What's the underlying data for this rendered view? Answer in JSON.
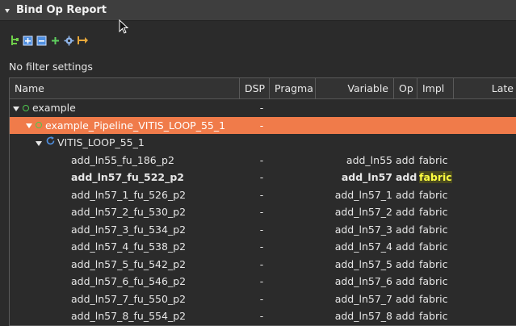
{
  "panel": {
    "title": "Bind Op Report"
  },
  "toolbar": {
    "icons": [
      "hierarchy-icon",
      "expand-all-icon",
      "collapse-all-icon",
      "add-icon",
      "settings-icon",
      "export-icon"
    ]
  },
  "filter": {
    "text": "No filter settings"
  },
  "table": {
    "columns": {
      "name": "Name",
      "dsp": "DSP",
      "pragma": "Pragma",
      "variable": "Variable",
      "op": "Op",
      "impl": "Impl",
      "latency": "Late"
    },
    "tree": {
      "root": {
        "label": "example",
        "dsp": "-"
      },
      "pipeline": {
        "label": "example_Pipeline_VITIS_LOOP_55_1",
        "dsp": "-"
      },
      "loop": {
        "label": "VITIS_LOOP_55_1"
      }
    },
    "rows": [
      {
        "name": "add_ln55_fu_186_p2",
        "dsp": "-",
        "variable": "add_ln55",
        "op": "add",
        "impl": "fabric"
      },
      {
        "name": "add_ln57_fu_522_p2",
        "dsp": "-",
        "variable": "add_ln57",
        "op": "add",
        "impl": "fabric"
      },
      {
        "name": "add_ln57_1_fu_526_p2",
        "dsp": "-",
        "variable": "add_ln57_1",
        "op": "add",
        "impl": "fabric"
      },
      {
        "name": "add_ln57_2_fu_530_p2",
        "dsp": "-",
        "variable": "add_ln57_2",
        "op": "add",
        "impl": "fabric"
      },
      {
        "name": "add_ln57_3_fu_534_p2",
        "dsp": "-",
        "variable": "add_ln57_3",
        "op": "add",
        "impl": "fabric"
      },
      {
        "name": "add_ln57_4_fu_538_p2",
        "dsp": "-",
        "variable": "add_ln57_4",
        "op": "add",
        "impl": "fabric"
      },
      {
        "name": "add_ln57_5_fu_542_p2",
        "dsp": "-",
        "variable": "add_ln57_5",
        "op": "add",
        "impl": "fabric"
      },
      {
        "name": "add_ln57_6_fu_546_p2",
        "dsp": "-",
        "variable": "add_ln57_6",
        "op": "add",
        "impl": "fabric"
      },
      {
        "name": "add_ln57_7_fu_550_p2",
        "dsp": "-",
        "variable": "add_ln57_7",
        "op": "add",
        "impl": "fabric"
      },
      {
        "name": "add_ln57_8_fu_554_p2",
        "dsp": "-",
        "variable": "add_ln57_8",
        "op": "add",
        "impl": "fabric"
      }
    ]
  },
  "colors": {
    "selected_row": "#f07b4a",
    "highlight_text": "#ffff40",
    "status_dot": "#4ec74e"
  }
}
